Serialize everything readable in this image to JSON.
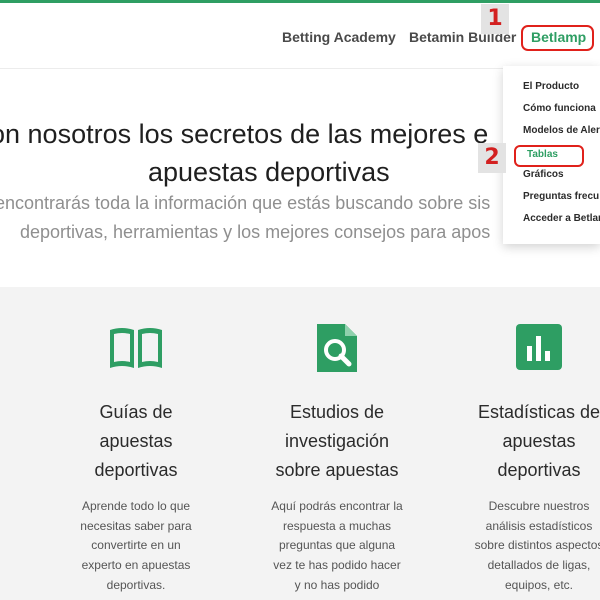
{
  "colors": {
    "brand": "#2e9e63",
    "annotation": "#e0211b"
  },
  "nav": {
    "links": [
      "Betting Academy",
      "Betamin Builder"
    ],
    "active_link": "Betlamp"
  },
  "annotations": {
    "marker_1": "1",
    "marker_2": "2"
  },
  "dropdown": {
    "items": [
      "El Producto",
      "Cómo funciona",
      "Modelos de Aler",
      "Tablas",
      "Gráficos",
      "Preguntas frecu",
      "Acceder a Betlam"
    ],
    "active_item": "Tablas"
  },
  "hero": {
    "title_line1": "on nosotros los secretos de las mejores e",
    "title_line2": "apuestas deportivas",
    "subtitle_line1": "encontrarás toda la información que estás buscando sobre sis",
    "subtitle_line2": "deportivas, herramientas y los mejores consejos para apos"
  },
  "features": [
    {
      "icon": "book-icon",
      "title_lines": [
        "Guías de",
        "apuestas",
        "deportivas"
      ],
      "text_lines": [
        "Aprende todo lo que",
        "necesitas saber para",
        "convertirte en un",
        "experto en apuestas",
        "deportivas."
      ]
    },
    {
      "icon": "document-search-icon",
      "title_lines": [
        "Estudios de",
        "investigación",
        "sobre apuestas"
      ],
      "text_lines": [
        "Aquí podrás encontrar la",
        "respuesta a muchas",
        "preguntas que alguna",
        "vez te has podido hacer",
        "y no has podido"
      ]
    },
    {
      "icon": "bar-chart-icon",
      "title_lines": [
        "Estadísticas de",
        "apuestas",
        "deportivas"
      ],
      "text_lines": [
        "Descubre nuestros",
        "análisis estadísticos",
        "sobre distintos aspectos",
        "detallados de ligas,",
        "equipos, etc."
      ]
    }
  ]
}
